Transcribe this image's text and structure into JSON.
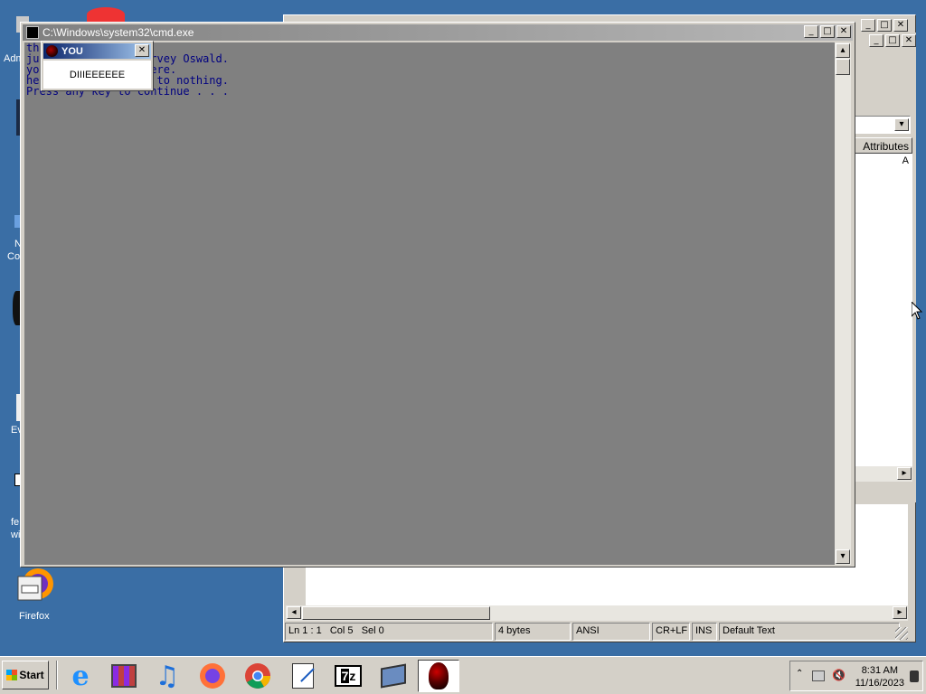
{
  "desktop": {
    "icons": [
      {
        "label": "Adm"
      },
      {
        "label": "N"
      },
      {
        "label": "Co"
      },
      {
        "label": "Ev"
      },
      {
        "label": "fe"
      },
      {
        "label": "wi"
      },
      {
        "label": "Firefox"
      }
    ]
  },
  "bg_window": {
    "column_header": "Attributes",
    "attr_value": "A",
    "status": {
      "position": "Ln 1 : 1   Col 5   Sel 0",
      "size": "4 bytes",
      "encoding": "ANSI",
      "line_endings": "CR+LF",
      "mode": "INS",
      "scheme": "Default Text"
    }
  },
  "cmd": {
    "title": "C:\\Windows\\system32\\cmd.exe",
    "lines": [
      "th",
      "ju                arvey Oswald.",
      "yo                here.",
      "he                d to nothing.",
      "",
      "Press any key to continue . . ."
    ]
  },
  "dialog": {
    "title": "YOU",
    "message": "DIIIEEEEEE"
  },
  "taskbar": {
    "start_label": "Start",
    "items": [
      {
        "icon": "internet-explorer-icon"
      },
      {
        "icon": "winrar-icon"
      },
      {
        "icon": "music-note-icon"
      },
      {
        "icon": "firefox-icon"
      },
      {
        "icon": "chrome-icon"
      },
      {
        "icon": "notepad-icon"
      },
      {
        "icon": "7zip-icon"
      },
      {
        "icon": "network-computer-icon"
      },
      {
        "icon": "red-skull-icon"
      }
    ],
    "clock_time": "8:31 AM",
    "clock_date": "11/16/2023"
  }
}
